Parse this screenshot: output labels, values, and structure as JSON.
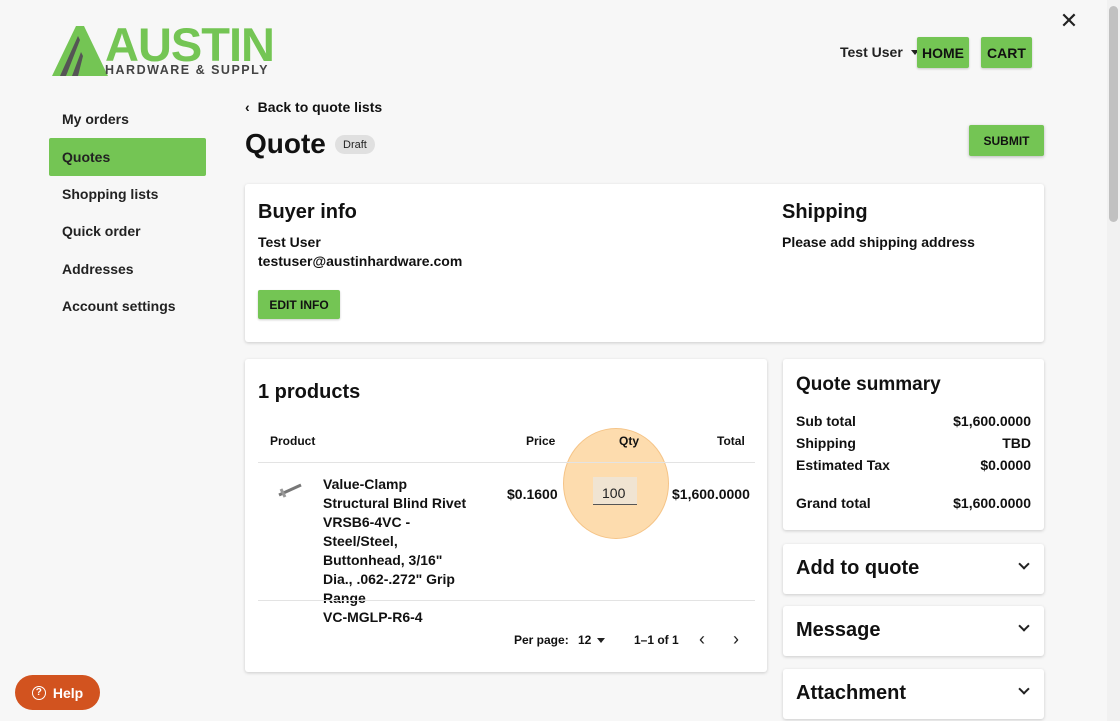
{
  "brand": {
    "name": "AUSTIN",
    "tagline": "HARDWARE & SUPPLY",
    "accent": "#74c554"
  },
  "header": {
    "user": "Test User",
    "home_label": "HOME",
    "cart_label": "CART",
    "close": "✕"
  },
  "sidebar": {
    "items": [
      {
        "label": "My orders"
      },
      {
        "label": "Quotes",
        "active": true
      },
      {
        "label": "Shopping lists"
      },
      {
        "label": "Quick order"
      },
      {
        "label": "Addresses"
      },
      {
        "label": "Account settings"
      }
    ]
  },
  "page": {
    "back": "Back to quote lists",
    "title": "Quote",
    "status": "Draft",
    "submit": "SUBMIT"
  },
  "buyer": {
    "heading": "Buyer info",
    "name": "Test User",
    "email": "testuser@austinhardware.com",
    "edit": "EDIT INFO"
  },
  "shipping": {
    "heading": "Shipping",
    "text": "Please add shipping address"
  },
  "products": {
    "heading": "1 products",
    "columns": {
      "product": "Product",
      "price": "Price",
      "qty": "Qty",
      "total": "Total"
    },
    "rows": [
      {
        "name": "Value-Clamp Structural Blind Rivet VRSB6-4VC - Steel/Steel, Buttonhead, 3/16\" Dia., .062-.272\" Grip Range",
        "sku": "VC-MGLP-R6-4",
        "price": "$0.1600",
        "qty": "100",
        "total": "$1,600.0000"
      }
    ],
    "pager": {
      "per_page_label": "Per page:",
      "per_page": "12",
      "range": "1–1 of 1"
    }
  },
  "summary": {
    "heading": "Quote summary",
    "rows": [
      {
        "label": "Sub total",
        "value": "$1,600.0000"
      },
      {
        "label": "Shipping",
        "value": "TBD"
      },
      {
        "label": "Estimated Tax",
        "value": "$0.0000"
      }
    ],
    "grand": {
      "label": "Grand total",
      "value": "$1,600.0000"
    }
  },
  "accordions": [
    {
      "label": "Add to quote"
    },
    {
      "label": "Message"
    },
    {
      "label": "Attachment"
    }
  ],
  "help": {
    "label": "Help"
  }
}
